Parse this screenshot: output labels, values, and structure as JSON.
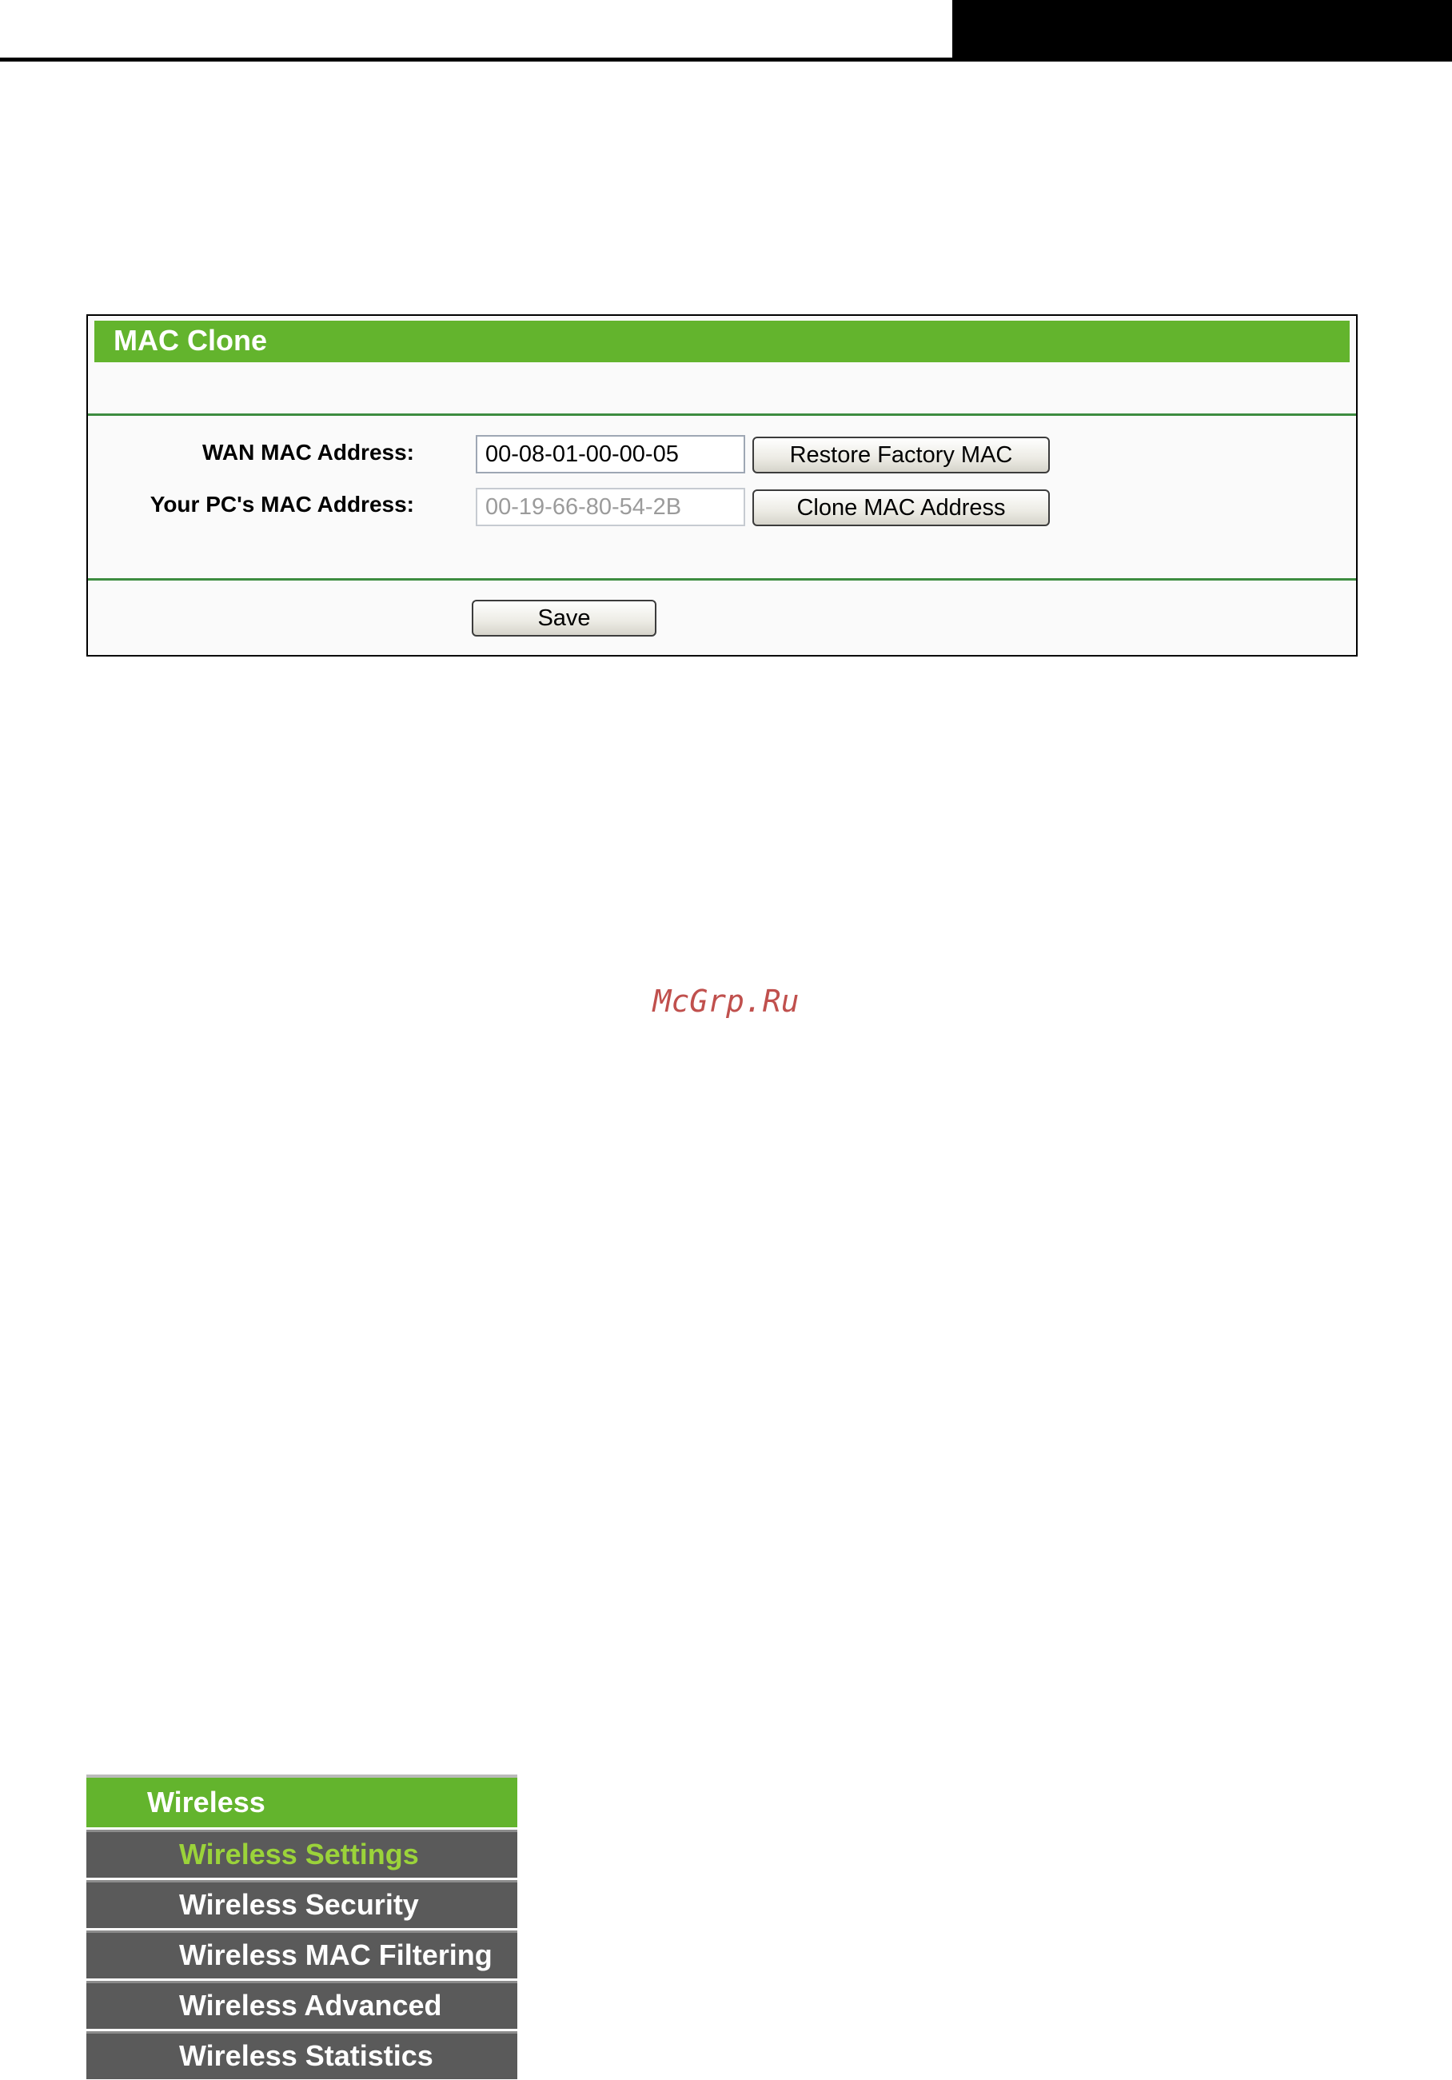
{
  "panel": {
    "title": "MAC Clone",
    "wan_label": "WAN MAC Address:",
    "wan_value": "00-08-01-00-00-05",
    "restore_button": "Restore Factory MAC",
    "pc_label": "Your PC's MAC Address:",
    "pc_value": "00-19-66-80-54-2B",
    "clone_button": "Clone MAC Address",
    "save_button": "Save"
  },
  "watermark": "McGrp.Ru",
  "menu": {
    "title": "Wireless",
    "items": [
      {
        "label": "Wireless Settings",
        "active": true
      },
      {
        "label": "Wireless Security"
      },
      {
        "label": "Wireless MAC Filtering"
      },
      {
        "label": "Wireless Advanced"
      },
      {
        "label": "Wireless Statistics"
      }
    ]
  },
  "colors": {
    "header_green": "#63b42d",
    "menu_gray": "#5a5a5a",
    "active_item": "#9bd33a"
  }
}
